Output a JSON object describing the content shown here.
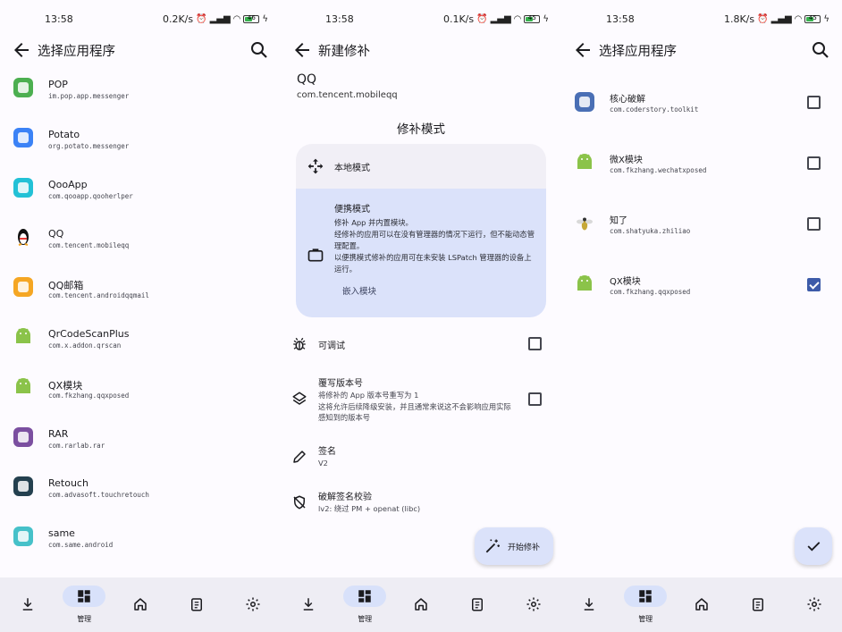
{
  "colors": {
    "accent": "#3d5ba9",
    "card_selected": "#dbe2fa",
    "card_plain": "#f1eff6",
    "nav_bg": "#eeedf4"
  },
  "screens": [
    {
      "status": {
        "time": "13:58",
        "speed": "0.2K/s",
        "battery": "46"
      },
      "appbar": {
        "title": "选择应用程序",
        "back_icon": "arrow-left-icon",
        "search_icon": "search-icon"
      },
      "apps": [
        {
          "name": "POP",
          "pkg": "im.pop.app.messenger",
          "icon_color": "#4caf50"
        },
        {
          "name": "Potato",
          "pkg": "org.potato.messenger",
          "icon_color": "#3b82f6"
        },
        {
          "name": "QooApp",
          "pkg": "com.qooapp.qooherlper",
          "icon_color": "#22c1d6"
        },
        {
          "name": "QQ",
          "pkg": "com.tencent.mobileqq",
          "icon_color": "#111111"
        },
        {
          "name": "QQ邮箱",
          "pkg": "com.tencent.androidqqmail",
          "icon_color": "#f5a623"
        },
        {
          "name": "QrCodeScanPlus",
          "pkg": "com.x.addon.qrscan",
          "icon_color": "#8bc34a"
        },
        {
          "name": "QX模块",
          "pkg": "com.fkzhang.qqxposed",
          "icon_color": "#8bc34a"
        },
        {
          "name": "RAR",
          "pkg": "com.rarlab.rar",
          "icon_color": "#7b4fa0"
        },
        {
          "name": "Retouch",
          "pkg": "com.advasoft.touchretouch",
          "icon_color": "#24404f"
        },
        {
          "name": "same",
          "pkg": "com.same.android",
          "icon_color": "#46c1c9"
        }
      ]
    },
    {
      "status": {
        "time": "13:58",
        "speed": "0.1K/s",
        "battery": "45"
      },
      "appbar": {
        "title": "新建修补",
        "back_icon": "arrow-left-icon"
      },
      "app": {
        "name": "QQ",
        "pkg": "com.tencent.mobileqq"
      },
      "section_title": "修补模式",
      "mode_local": {
        "label": "本地模式",
        "icon": "move-arrows-icon"
      },
      "mode_portable": {
        "label": "便携模式",
        "icon": "briefcase-icon",
        "lines": [
          "修补 App 并内置模块。",
          "经修补的应用可以在没有管理器的情况下运行，但不能动态管理配置。",
          "以便携模式修补的应用可在未安装 LSPatch 管理器的设备上运行。"
        ],
        "embed": "嵌入模块"
      },
      "options": [
        {
          "title": "可调试",
          "icon": "bug-icon",
          "checked": false
        },
        {
          "title": "覆写版本号",
          "icon": "layers-icon",
          "checked": false,
          "desc": [
            "将修补的 App 版本号重写为 1",
            "这将允许后续降级安装，并且通常来说这不会影响应用实际感知到的版本号"
          ]
        },
        {
          "title": "签名",
          "icon": "pen-icon",
          "value": "V2"
        },
        {
          "title": "破解签名校验",
          "icon": "shield-off-icon",
          "value": "lv2: 绕过 PM + openat (libc)"
        }
      ],
      "fab_label": "开始修补"
    },
    {
      "status": {
        "time": "13:58",
        "speed": "1.8K/s",
        "battery": "45"
      },
      "appbar": {
        "title": "选择应用程序",
        "back_icon": "arrow-left-icon",
        "search_icon": "search-icon"
      },
      "modules": [
        {
          "name": "核心破解",
          "pkg": "com.coderstory.toolkit",
          "checked": false,
          "icon_color": "#4a6fb5"
        },
        {
          "name": "微X模块",
          "pkg": "com.fkzhang.wechatxposed",
          "checked": false,
          "icon_color": "#8bc34a"
        },
        {
          "name": "知了",
          "pkg": "com.shatyuka.zhiliao",
          "checked": false,
          "icon_color": "#c6a838"
        },
        {
          "name": "QX模块",
          "pkg": "com.fkzhang.qqxposed",
          "checked": true,
          "icon_color": "#8bc34a"
        }
      ]
    }
  ],
  "nav": {
    "items": [
      {
        "icon": "download-icon",
        "label": ""
      },
      {
        "icon": "dashboard-icon",
        "label": "管理",
        "active": true
      },
      {
        "icon": "home-icon",
        "label": ""
      },
      {
        "icon": "clipboard-icon",
        "label": ""
      },
      {
        "icon": "gear-icon",
        "label": ""
      }
    ]
  }
}
